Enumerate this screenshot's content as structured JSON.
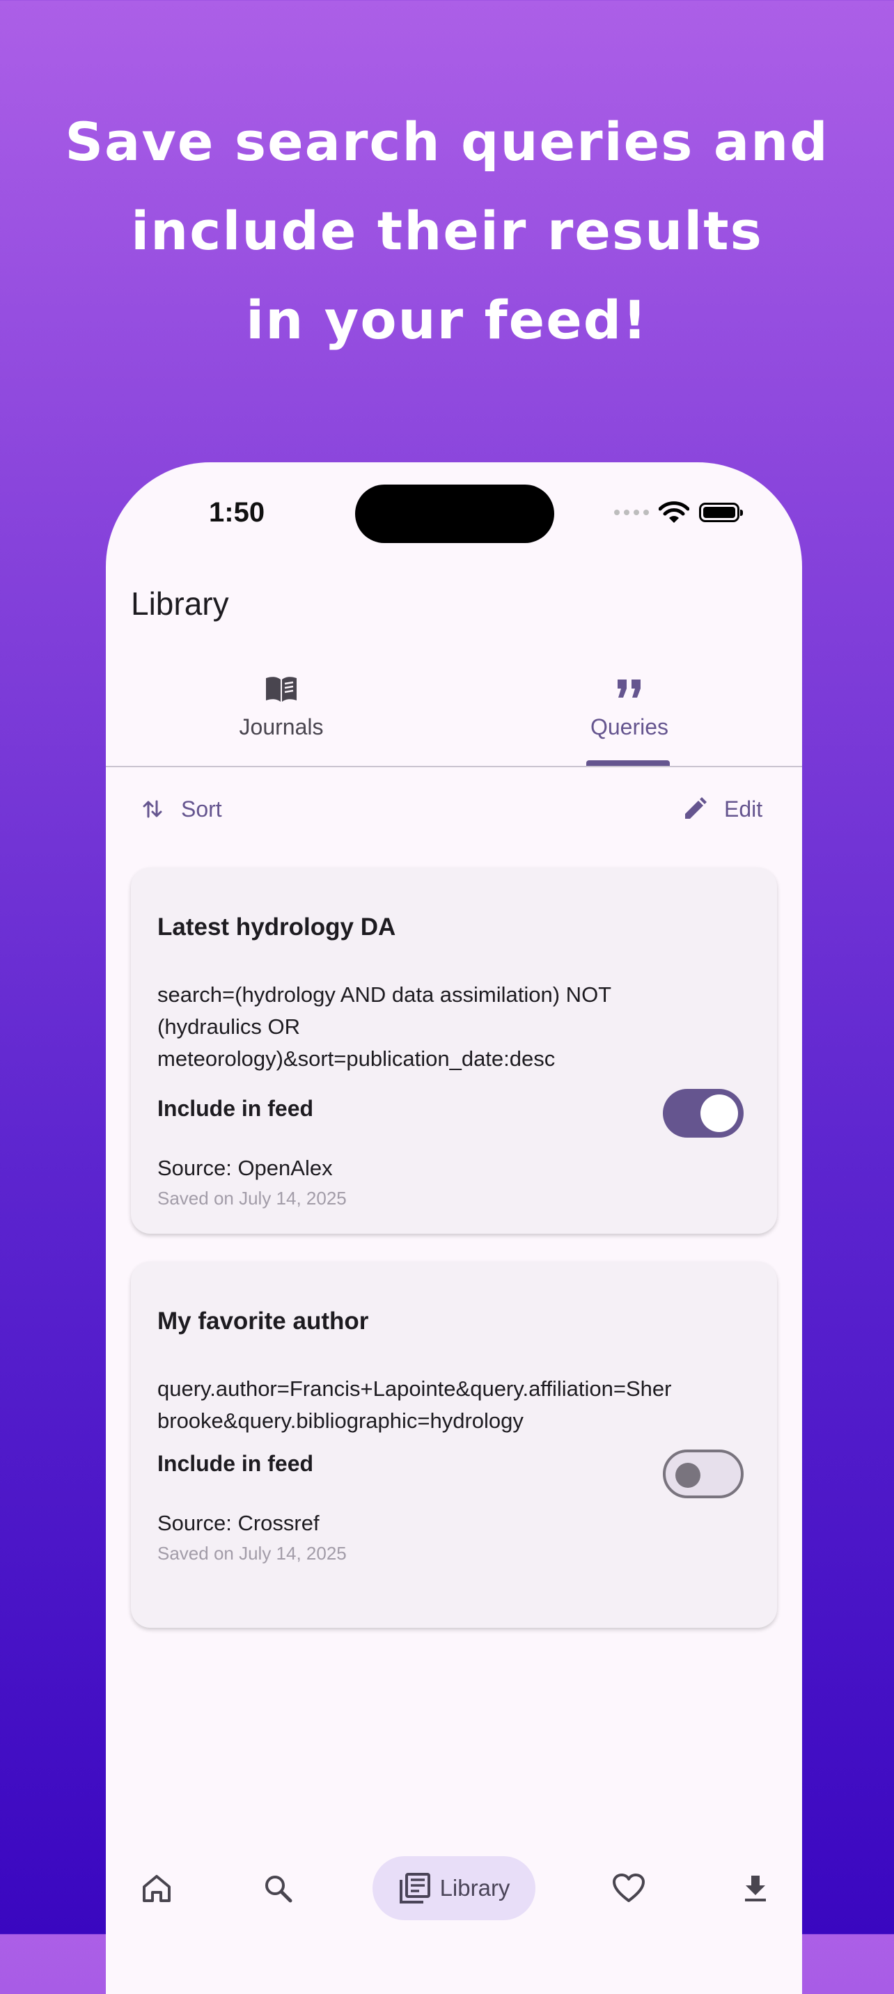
{
  "headline": {
    "line1": "Save search queries and",
    "line2": "include their results",
    "line3": "in your feed!"
  },
  "status_bar": {
    "time": "1:50"
  },
  "app_bar": {
    "title": "Library"
  },
  "tabs": [
    {
      "label": "Journals",
      "icon": "book-open-icon",
      "selected": false
    },
    {
      "label": "Queries",
      "icon": "quote-icon",
      "selected": true
    }
  ],
  "actions": {
    "sort_label": "Sort",
    "edit_label": "Edit"
  },
  "queries": [
    {
      "title": "Latest hydrology DA",
      "query_line1": "search=(hydrology AND data assimilation) NOT",
      "query_line2": "(hydraulics OR",
      "query_line3": "meteorology)&sort=publication_date:desc",
      "include_label": "Include in feed",
      "include_in_feed": true,
      "source": "Source: OpenAlex",
      "saved": "Saved on July 14, 2025"
    },
    {
      "title": "My favorite author",
      "query_line1": "query.author=Francis+Lapointe&query.affiliation=Sher",
      "query_line2": "brooke&query.bibliographic=hydrology",
      "include_label": "Include in feed",
      "include_in_feed": false,
      "source": "Source: Crossref",
      "saved": "Saved on July 14, 2025"
    }
  ],
  "bottom_nav": [
    {
      "icon": "home-icon"
    },
    {
      "icon": "search-icon"
    },
    {
      "icon": "library-icon",
      "label": "Library",
      "selected": true
    },
    {
      "icon": "heart-icon"
    },
    {
      "icon": "download-icon"
    }
  ],
  "colors": {
    "primary": "#65558f",
    "background": "#fdf7fd",
    "card": "#f5f0f6",
    "nav_indicator": "#e8def8",
    "gradient_top": "#ac5fe7",
    "gradient_bottom": "#3a07c0"
  }
}
